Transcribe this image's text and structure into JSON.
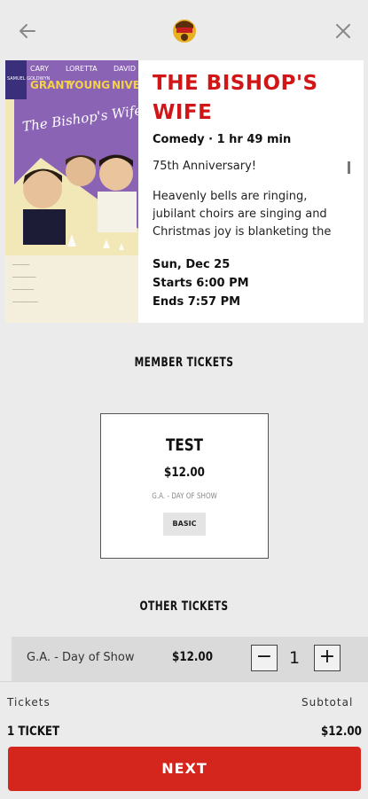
{
  "header": {
    "back_icon": "arrow-left-icon",
    "close_icon": "close-icon",
    "logo": "theater-logo"
  },
  "movie": {
    "title": "THE BISHOP'S WIFE",
    "meta": "Comedy · 1 hr 49 min",
    "description": [
      "75th Anniversary!",
      "Heavenly bells are ringing, jubilant choirs are singing and Christmas joy is blanketing the"
    ],
    "date": "Sun, Dec 25",
    "starts": "Starts 6:00 PM",
    "ends": "Ends 7:57 PM",
    "poster": {
      "billing": [
        "CARY",
        "LORETTA",
        "DAVID"
      ],
      "billing_last": [
        "GRANT",
        "YOUNG",
        "NIVEN"
      ],
      "poster_title": "The Bishop's Wife",
      "side_text": "SAMUEL GOLDWYN"
    }
  },
  "member_tickets": {
    "heading": "MEMBER TICKETS",
    "card": {
      "name": "TEST",
      "price": "$12.00",
      "type": "G.A. - DAY OF SHOW",
      "badge": "BASIC"
    }
  },
  "other_tickets": {
    "heading": "OTHER TICKETS",
    "row": {
      "name": "G.A. - Day of Show",
      "price": "$12.00",
      "quantity": "1",
      "minus": "−",
      "plus": "+"
    }
  },
  "footer": {
    "tickets_label": "Tickets",
    "subtotal_label": "Subtotal",
    "ticket_count": "1 TICKET",
    "subtotal_value": "$12.00",
    "next_label": "NEXT"
  },
  "colors": {
    "accent_red": "#d01616",
    "button_red": "#d4261c",
    "poster_purple": "#8a63b4"
  }
}
